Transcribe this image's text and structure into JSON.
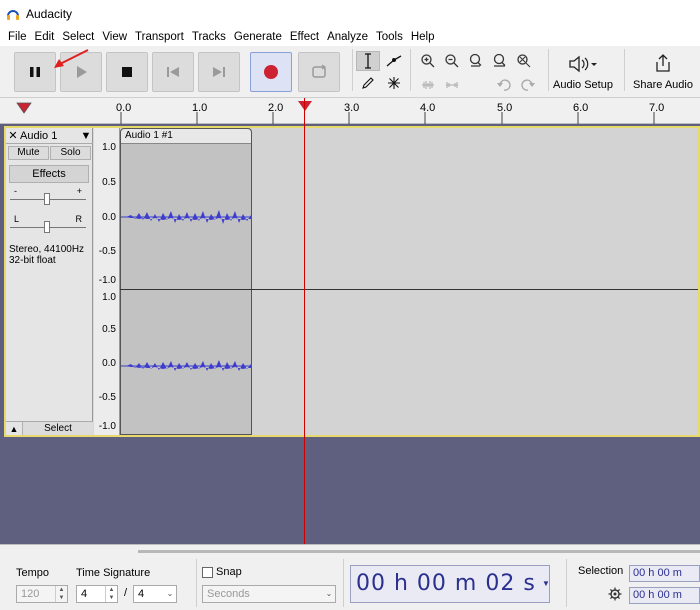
{
  "window": {
    "title": "Audacity"
  },
  "menu": [
    "File",
    "Edit",
    "Select",
    "View",
    "Transport",
    "Tracks",
    "Generate",
    "Effect",
    "Analyze",
    "Tools",
    "Help"
  ],
  "toolbar": {
    "audio_setup_label": "Audio Setup",
    "share_audio_label": "Share Audio"
  },
  "ruler": {
    "ticks": [
      "0.0",
      "1.0",
      "2.0",
      "3.0",
      "4.0",
      "5.0",
      "6.0",
      "7.0"
    ]
  },
  "track": {
    "name": "Audio 1",
    "mute_label": "Mute",
    "solo_label": "Solo",
    "effects_label": "Effects",
    "gain_minus": "-",
    "gain_plus": "+",
    "pan_left": "L",
    "pan_right": "R",
    "info_line1": "Stereo, 44100Hz",
    "info_line2": "32-bit float",
    "select_label": "Select",
    "clip_name": "Audio 1 #1",
    "scale_top": [
      "1.0",
      "0.5",
      "0.0",
      "-0.5",
      "-1.0"
    ],
    "scale_bottom": [
      "1.0",
      "0.5",
      "0.0",
      "-0.5",
      "-1.0"
    ]
  },
  "bottom": {
    "tempo_label": "Tempo",
    "tempo_value": "120",
    "time_signature_label": "Time Signature",
    "ts_numerator": "4",
    "ts_slash": "/",
    "ts_denominator": "4",
    "snap_label": "Snap",
    "snap_unit": "Seconds",
    "time_display": "00 h 00 m 02 s",
    "selection_label": "Selection",
    "selection_start": "00 h 00 m",
    "selection_end": "00 h 00 m"
  },
  "colors": {
    "accent_record": "#cc2233",
    "waveform": "#3c3ccf",
    "track_border": "#e7d96b",
    "empty_area": "#5f6080",
    "time_text": "#2b2f8f"
  }
}
